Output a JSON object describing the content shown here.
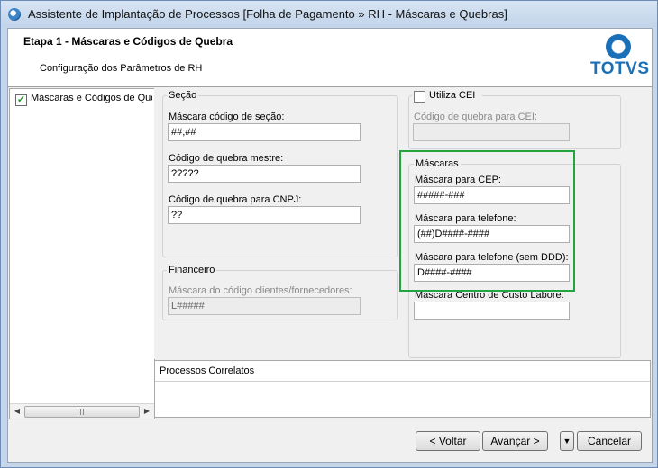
{
  "window": {
    "title": "Assistente de Implantação de Processos [Folha de Pagamento » RH - Máscaras e Quebras]"
  },
  "header": {
    "step_title": "Etapa 1 - Máscaras e Códigos de Quebra",
    "step_subtitle": "Configuração dos Parâmetros de RH",
    "logo_text": "TOTVS"
  },
  "tree": {
    "items": [
      {
        "label": "Máscaras e Códigos de Quebra",
        "checked": true
      }
    ]
  },
  "secao": {
    "title": "Seção",
    "mascara_secao": {
      "label": "Máscara código de seção:",
      "value": "##;##"
    },
    "quebra_mestre": {
      "label": "Código de quebra mestre:",
      "value": "?????"
    },
    "quebra_cnpj": {
      "label": "Código de quebra para CNPJ:",
      "value": "??"
    }
  },
  "financeiro": {
    "title": "Financeiro",
    "mascara_cli": {
      "label": "Máscara do código clientes/fornecedores:",
      "value": "L#####"
    }
  },
  "cei": {
    "checkbox_label": "Utiliza CEI",
    "checked": false,
    "quebra_cei": {
      "label": "Código de quebra para CEI:",
      "value": ""
    }
  },
  "mascaras": {
    "title": "Máscaras",
    "cep": {
      "label": "Máscara para CEP:",
      "value": "#####-###"
    },
    "telefone": {
      "label": "Máscara para telefone:",
      "value": "(##)D####-####"
    },
    "telefone_sem_ddd": {
      "label": "Máscara para telefone (sem DDD):",
      "value": "D####-####"
    },
    "centro_custo": {
      "label": "Máscara Centro de Custo Labore:",
      "value": ""
    }
  },
  "correlatos": {
    "title": "Processos Correlatos"
  },
  "buttons": {
    "voltar_pre": "< ",
    "voltar_key": "V",
    "voltar_post": "oltar",
    "avancar_pre": "Avan",
    "avancar_key": "ç",
    "avancar_post": "ar >",
    "menu_arrow": "▼",
    "cancelar_key": "C",
    "cancelar_post": "ancelar"
  },
  "colors": {
    "highlight": "#22a540",
    "brand": "#1b6fb7"
  }
}
